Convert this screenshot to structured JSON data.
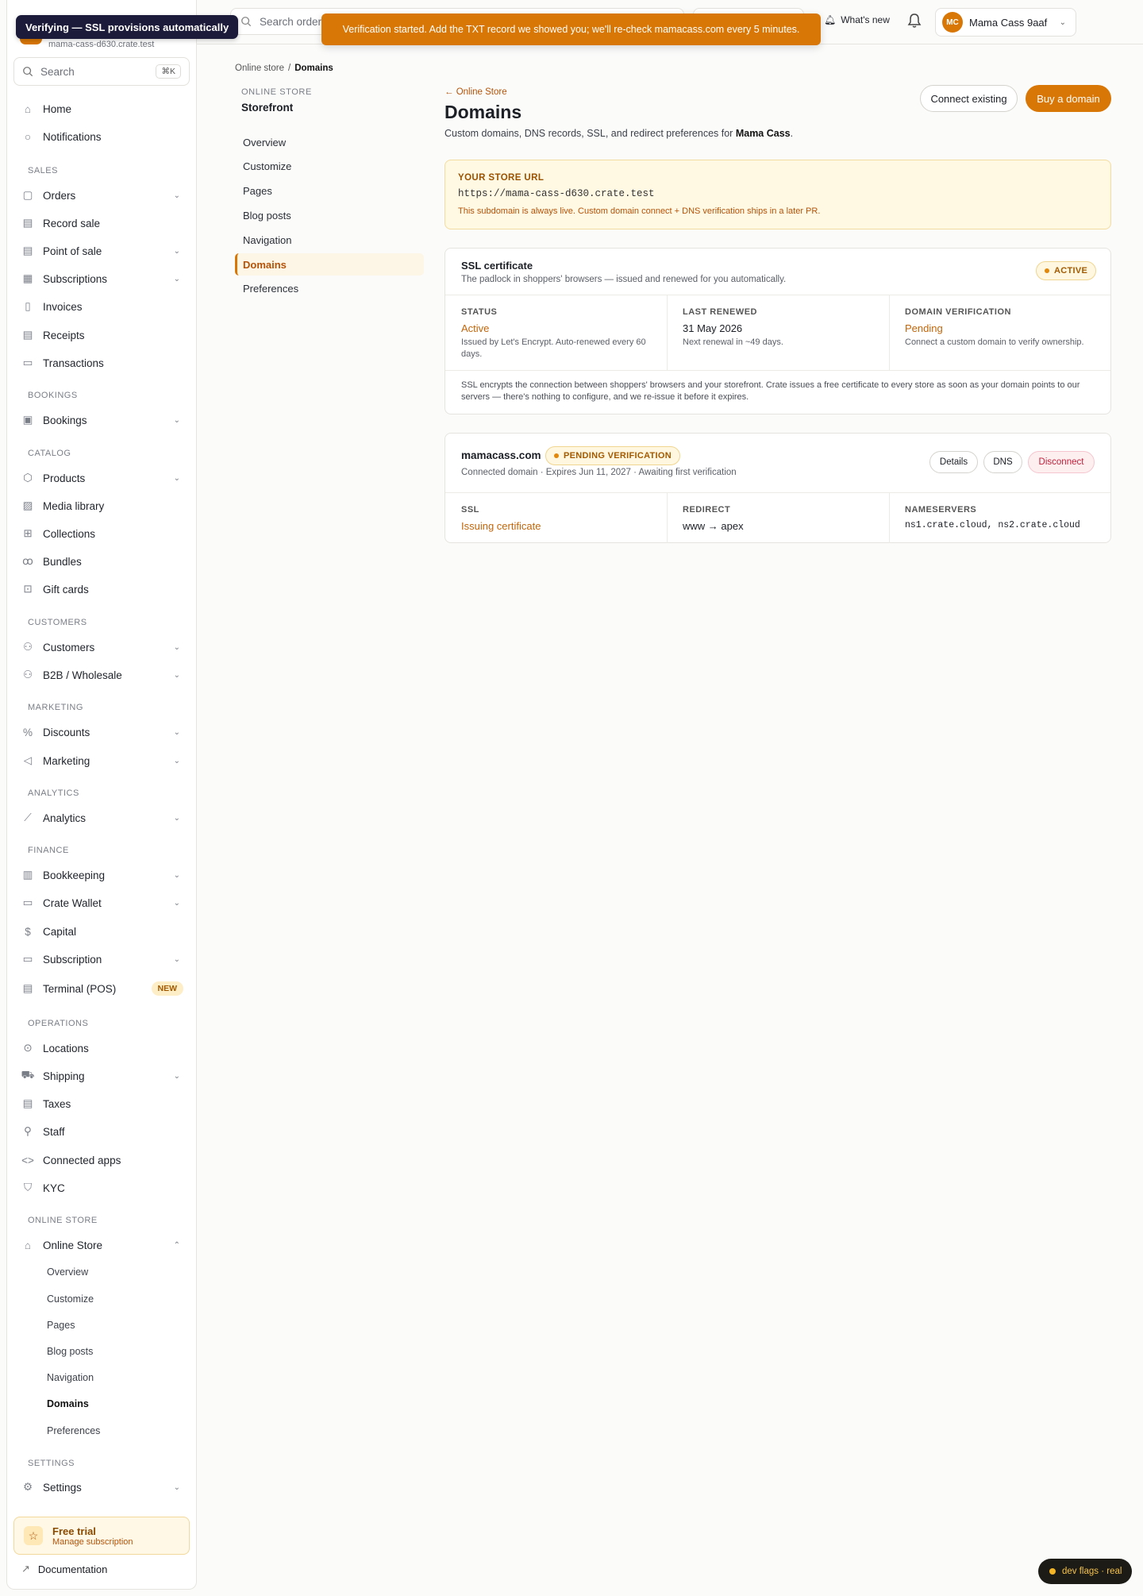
{
  "toasts": {
    "verifying": "Verifying — SSL provisions automatically",
    "verification": "Verification started. Add the TXT record we showed you; we'll re-check mamacass.com every 5 minutes."
  },
  "sidebar": {
    "org_host": "mama-cass-d630.crate.test",
    "search_placeholder": "Search",
    "search_shortcut": "⌘K",
    "items": {
      "home": "Home",
      "notifications": "Notifications",
      "sec_sales": "SALES",
      "orders": "Orders",
      "record_sale": "Record sale",
      "point_of_sale": "Point of sale",
      "subscriptions": "Subscriptions",
      "invoices": "Invoices",
      "receipts": "Receipts",
      "transactions": "Transactions",
      "sec_bookings": "BOOKINGS",
      "bookings": "Bookings",
      "sec_catalog": "CATALOG",
      "products": "Products",
      "media_library": "Media library",
      "collections": "Collections",
      "bundles": "Bundles",
      "gift_cards": "Gift cards",
      "sec_customers": "CUSTOMERS",
      "customers": "Customers",
      "b2b": "B2B / Wholesale",
      "sec_marketing": "MARKETING",
      "discounts": "Discounts",
      "marketing": "Marketing",
      "sec_analytics": "ANALYTICS",
      "analytics": "Analytics",
      "sec_finance": "FINANCE",
      "bookkeeping": "Bookkeeping",
      "crate_wallet": "Crate Wallet",
      "capital": "Capital",
      "subscription": "Subscription",
      "terminal": "Terminal (POS)",
      "terminal_badge": "NEW",
      "sec_operations": "OPERATIONS",
      "locations": "Locations",
      "shipping": "Shipping",
      "taxes": "Taxes",
      "staff": "Staff",
      "connected_apps": "Connected apps",
      "kyc": "KYC",
      "sec_online_store": "ONLINE STORE",
      "online_store": "Online Store",
      "sub_overview": "Overview",
      "sub_customize": "Customize",
      "sub_pages": "Pages",
      "sub_blog": "Blog posts",
      "sub_navigation": "Navigation",
      "sub_domains": "Domains",
      "sub_preferences": "Preferences",
      "sec_settings": "SETTINGS",
      "settings": "Settings"
    },
    "trial_title": "Free trial",
    "trial_link": "Manage subscription",
    "documentation": "Documentation"
  },
  "topbar": {
    "search_placeholder": "Search orders",
    "whats_new": "What's new",
    "account_initials": "MC",
    "account_name": "Mama Cass 9aaf"
  },
  "breadcrumb": {
    "parent": "Online store",
    "sep": "/",
    "current": "Domains"
  },
  "subnav": {
    "section": "ONLINE STORE",
    "title": "Storefront",
    "items": [
      "Overview",
      "Customize",
      "Pages",
      "Blog posts",
      "Navigation",
      "Domains",
      "Preferences"
    ]
  },
  "page": {
    "back": "← Online Store",
    "title": "Domains",
    "subtitle_pre": "Custom domains, DNS records, SSL, and redirect preferences for ",
    "subtitle_store": "Mama Cass",
    "subtitle_post": ".",
    "connect_existing": "Connect existing",
    "buy_domain": "Buy a domain"
  },
  "store_url": {
    "label": "YOUR STORE URL",
    "url": "https://mama-cass-d630.crate.test",
    "note": "This subdomain is always live. Custom domain connect + DNS verification ships in a later PR."
  },
  "ssl": {
    "title": "SSL certificate",
    "desc": "The padlock in shoppers' browsers — issued and renewed for you automatically.",
    "badge": "ACTIVE",
    "status_label": "STATUS",
    "status_value": "Active",
    "status_note": "Issued by Let's Encrypt. Auto-renewed every 60 days.",
    "renewed_label": "LAST RENEWED",
    "renewed_value": "31 May 2026",
    "renewed_note": "Next renewal in ~49 days.",
    "verify_label": "DOMAIN VERIFICATION",
    "verify_value": "Pending",
    "verify_note": "Connect a custom domain to verify ownership.",
    "footer": "SSL encrypts the connection between shoppers' browsers and your storefront. Crate issues a free certificate to every store as soon as your domain points to our servers — there's nothing to configure, and we re-issue it before it expires."
  },
  "domain": {
    "name": "mamacass.com",
    "badge": "PENDING VERIFICATION",
    "meta": "Connected domain · Expires Jun 11, 2027 · Awaiting first verification",
    "details": "Details",
    "dns": "DNS",
    "disconnect": "Disconnect",
    "ssl_label": "SSL",
    "ssl_value": "Issuing certificate",
    "redirect_label": "REDIRECT",
    "redirect_value": "www → apex",
    "ns_label": "NAMESERVERS",
    "ns_value": "ns1.crate.cloud, ns2.crate.cloud"
  },
  "devflags": "dev flags · real",
  "colors": {
    "accent": "#d97706",
    "danger": "#c0223a",
    "toast_dark": "#1c1b3a"
  }
}
